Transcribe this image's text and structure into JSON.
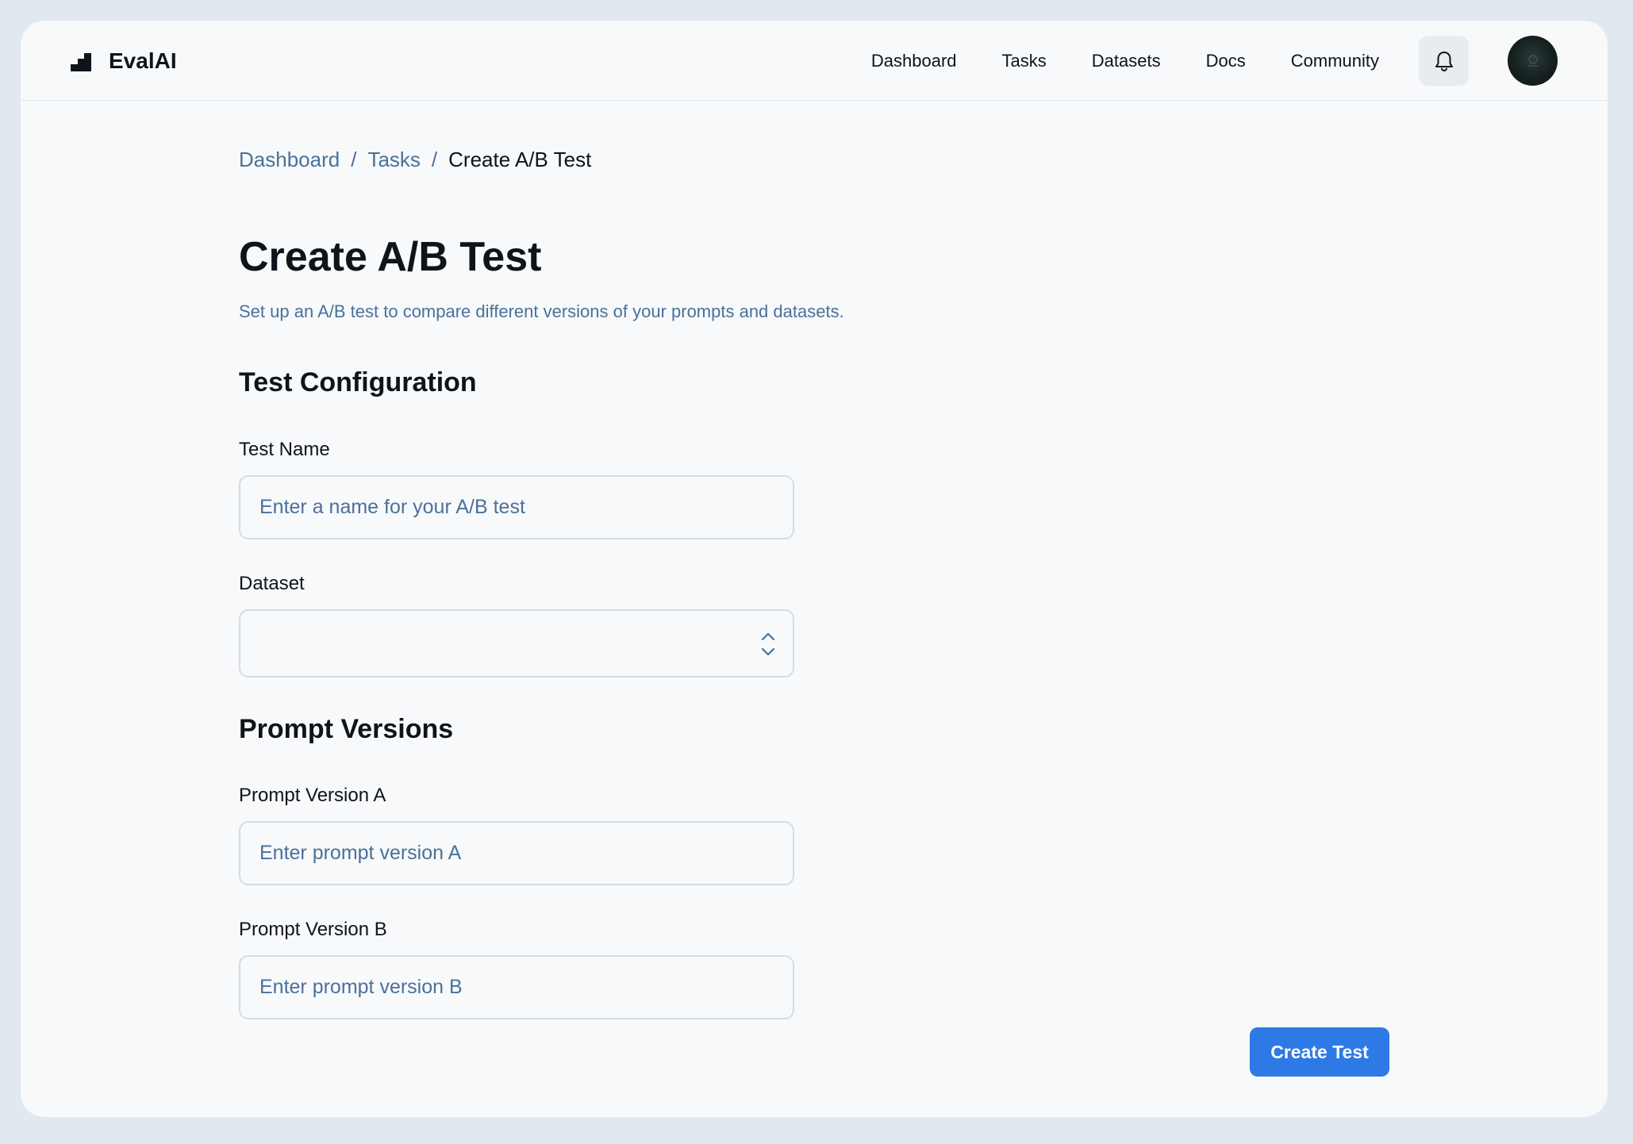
{
  "app": {
    "name": "EvalAI",
    "logo_icon": "logo-bars-icon"
  },
  "nav": {
    "items": [
      {
        "label": "Dashboard"
      },
      {
        "label": "Tasks"
      },
      {
        "label": "Datasets"
      },
      {
        "label": "Docs"
      },
      {
        "label": "Community"
      }
    ],
    "notifications_icon": "bell-icon"
  },
  "breadcrumb": {
    "items": [
      {
        "label": "Dashboard"
      },
      {
        "label": "Tasks"
      }
    ],
    "separator": "/",
    "current": "Create A/B Test"
  },
  "page": {
    "title": "Create A/B Test",
    "subtitle": "Set up an A/B test to compare different versions of your prompts and datasets."
  },
  "test_configuration": {
    "heading": "Test Configuration",
    "test_name": {
      "label": "Test Name",
      "value": "",
      "placeholder": "Enter a name for your A/B test"
    },
    "dataset": {
      "label": "Dataset",
      "selected": ""
    }
  },
  "prompt_versions": {
    "heading": "Prompt Versions",
    "version_a": {
      "label": "Prompt Version A",
      "value": "",
      "placeholder": "Enter prompt version A"
    },
    "version_b": {
      "label": "Prompt Version B",
      "value": "",
      "placeholder": "Enter prompt version B"
    }
  },
  "actions": {
    "submit_label": "Create Test"
  },
  "colors": {
    "accent": "#2d7ae6",
    "link": "#4b7199",
    "background": "#f7f9fb",
    "outer_background": "#e1e8ef"
  }
}
